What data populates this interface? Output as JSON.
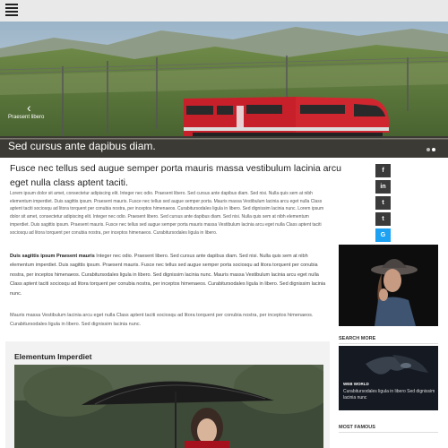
{
  "nav": {
    "menu_icon": "hamburger-menu-icon"
  },
  "hero": {
    "category": "Praesent libero",
    "title": "Sed cursus ante dapibus diam.",
    "prev_icon": "chevron-left-icon",
    "slides": 2,
    "active_slide": 1
  },
  "article": {
    "headline": "Fusce nec tellus sed augue semper porta mauris massa vestibulum lacinia arcu eget nulla class aptent taciti.",
    "para1": "Lorem ipsum dolor sit amet, consectetur adipiscing elit. Integer nec odio. Praesent libero. Sed cursus ante dapibus diam. Sed nisi. Nulla quis sem at nibh elementum imperdiet. Duis sagittis ipsum. Praesent mauris. Fusce nec tellus sed augue semper porta. Mauris massa Vestibulum lacinia arcu eget nulla Class aptent taciti sociosqu ad litora torquent per conubia nostra, per inceptos himenaeos. Curabitursodales ligula in libero. Sed dignissim lacinia nunc. Lorem ipsum dolor sit amet, consectetur adipiscing elit. Integer nec odio. Praesent libero. Sed cursus ante dapibus diam. Sed nisi. Nulla quis sem at nibh elementum imperdiet. Duis sagittis ipsum. Praesent mauris. Fusce nec tellus sed augue semper porta mauris massa Vestibulum lacinia arcu eget nulla Class aptent taciti sociosqu ad litora torquent per conubia nostra, per inceptos himenaeos. Curabitursodales ligula in libero.",
    "para2_lead": "Duis sagittis ipsum Praesent mauris",
    "para2": " Integer nec odio. Praesent libero. Sed cursus ante dapibus diam. Sed nisi. Nulla quis sem at nibh elementum imperdiet. Duis sagittis ipsum. Praesent mauris. Fusce nec tellus sed augue semper porta sociosqu ad litora torquent per conubia nostra, per inceptos himenaeos. Curabitursodales ligula in libero. Sed dignissim lacinia nunc. Mauris massa Vestibulum lacinia arcu eget nulla Class aptent taciti sociosqu ad litora torquent per conubia nostra, per inceptos himenaeos. Curabitursodales ligula in libero. Sed dignissim lacinia nunc.",
    "para3": "Mauris massa Vestibulum lacinia arcu eget nulla Class aptent taciti sociosqu ad litora torquent per conubia nostra, per inceptos himenaeos. Curabitursodales ligula in libero. Sed dignissim lacinia nunc."
  },
  "social": [
    {
      "label": "f",
      "icon": "facebook-icon",
      "color": "#3b3b3b"
    },
    {
      "label": "in",
      "icon": "linkedin-icon",
      "color": "#3b3b3b"
    },
    {
      "label": "t",
      "icon": "twitter-icon",
      "color": "#3b3b3b"
    },
    {
      "label": "t",
      "icon": "tumblr-icon",
      "color": "#3b3b3b"
    },
    {
      "label": "G",
      "icon": "google-icon",
      "color": "#1da1f2"
    }
  ],
  "elementum": {
    "title": "Elementum Imperdiet"
  },
  "sidebar": {
    "search_more": "SEARCH MORE",
    "card_tag": "WEB WORLD",
    "card_text": "Curabitursodales ligula in libero Sed dignissim lacinia nunc",
    "most_famous": "MOST FAMOUS"
  }
}
